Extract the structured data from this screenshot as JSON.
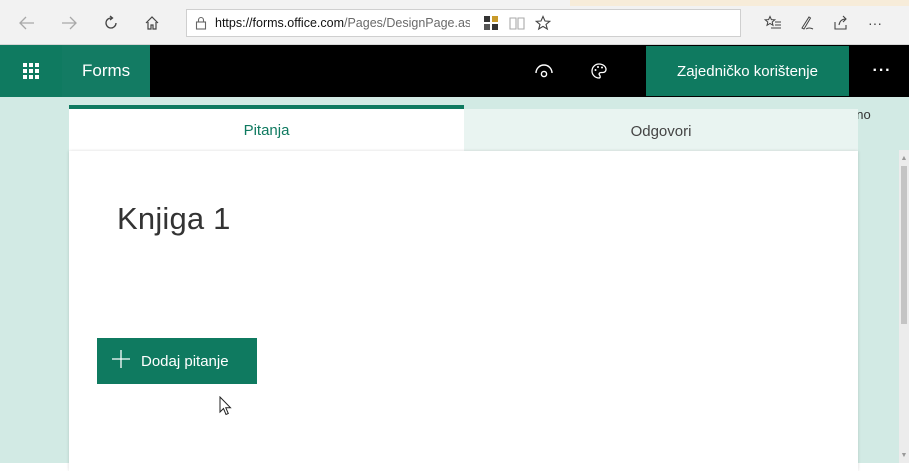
{
  "browser": {
    "url_host": "https://forms.office.com",
    "url_path": "/Pages/DesignPage.aspx?Action=Create&auth_pvr=Or",
    "icons": [
      "back-arrow-icon",
      "forward-arrow-icon",
      "refresh-icon",
      "home-icon",
      "lock-icon",
      "extension-icon",
      "reading-view-icon",
      "star-icon",
      "favorites-icon",
      "pen-icon",
      "share-icon",
      "more-icon"
    ]
  },
  "appbar": {
    "brand": "Forms",
    "share_label": "Zajedničko korištenje",
    "more_label": "···",
    "icons": [
      "app-launcher-icon",
      "preview-icon",
      "theme-icon"
    ]
  },
  "status": {
    "saved": "Spremljeno"
  },
  "tabs": {
    "questions": "Pitanja",
    "responses": "Odgovori"
  },
  "form": {
    "title": "Knjiga 1",
    "add_question_label": "Dodaj pitanje",
    "add_question_icon": "plus-icon"
  },
  "colors": {
    "accent": "#0f7a60",
    "page_bg": "#d2eae4",
    "appbar_bg": "#000000"
  }
}
